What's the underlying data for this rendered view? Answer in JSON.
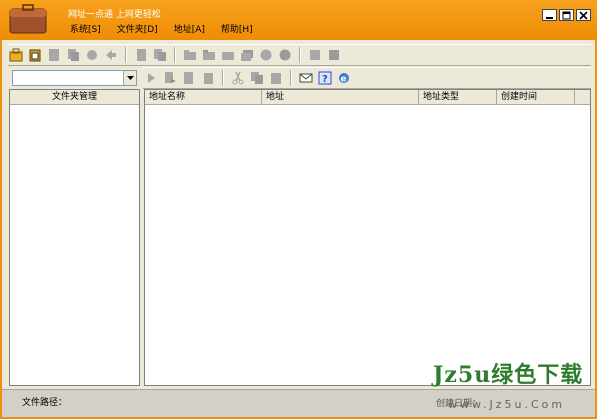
{
  "window": {
    "title": "网址一点通  上网更轻松",
    "accent_color": "#f09010"
  },
  "menu": [
    {
      "label": "系统[S]"
    },
    {
      "label": "文件夹[D]"
    },
    {
      "label": "地址[A]"
    },
    {
      "label": "帮助[H]"
    }
  ],
  "toolbar1_icons": [
    "open-folder-icon",
    "paste-icon",
    "page-icon",
    "page-copy-icon",
    "globe-icon",
    "arrow-icon",
    "doc-icon",
    "doc-copy-icon",
    "folder-icon",
    "folder-open-icon",
    "folder-move-icon",
    "folder-copy-icon",
    "globe2-icon",
    "globe3-icon",
    "square-icon",
    "square2-icon"
  ],
  "toolbar2_icons": [
    "play-icon",
    "doc-arrow-icon",
    "doc-star-icon",
    "doc-move-icon",
    "cut-icon",
    "copy-icon",
    "paste2-icon",
    "mail-icon",
    "help-icon",
    "ie-icon"
  ],
  "left_panel": {
    "header": "文件夹管理"
  },
  "list": {
    "columns": [
      "地址名称",
      "地址",
      "地址类型",
      "创建时间"
    ]
  },
  "status": {
    "path_label": "文件路径：",
    "date_label": "创建日期："
  },
  "watermark": {
    "main": "Jz5u绿色下载",
    "sub": "www.Jz5u.Com"
  }
}
